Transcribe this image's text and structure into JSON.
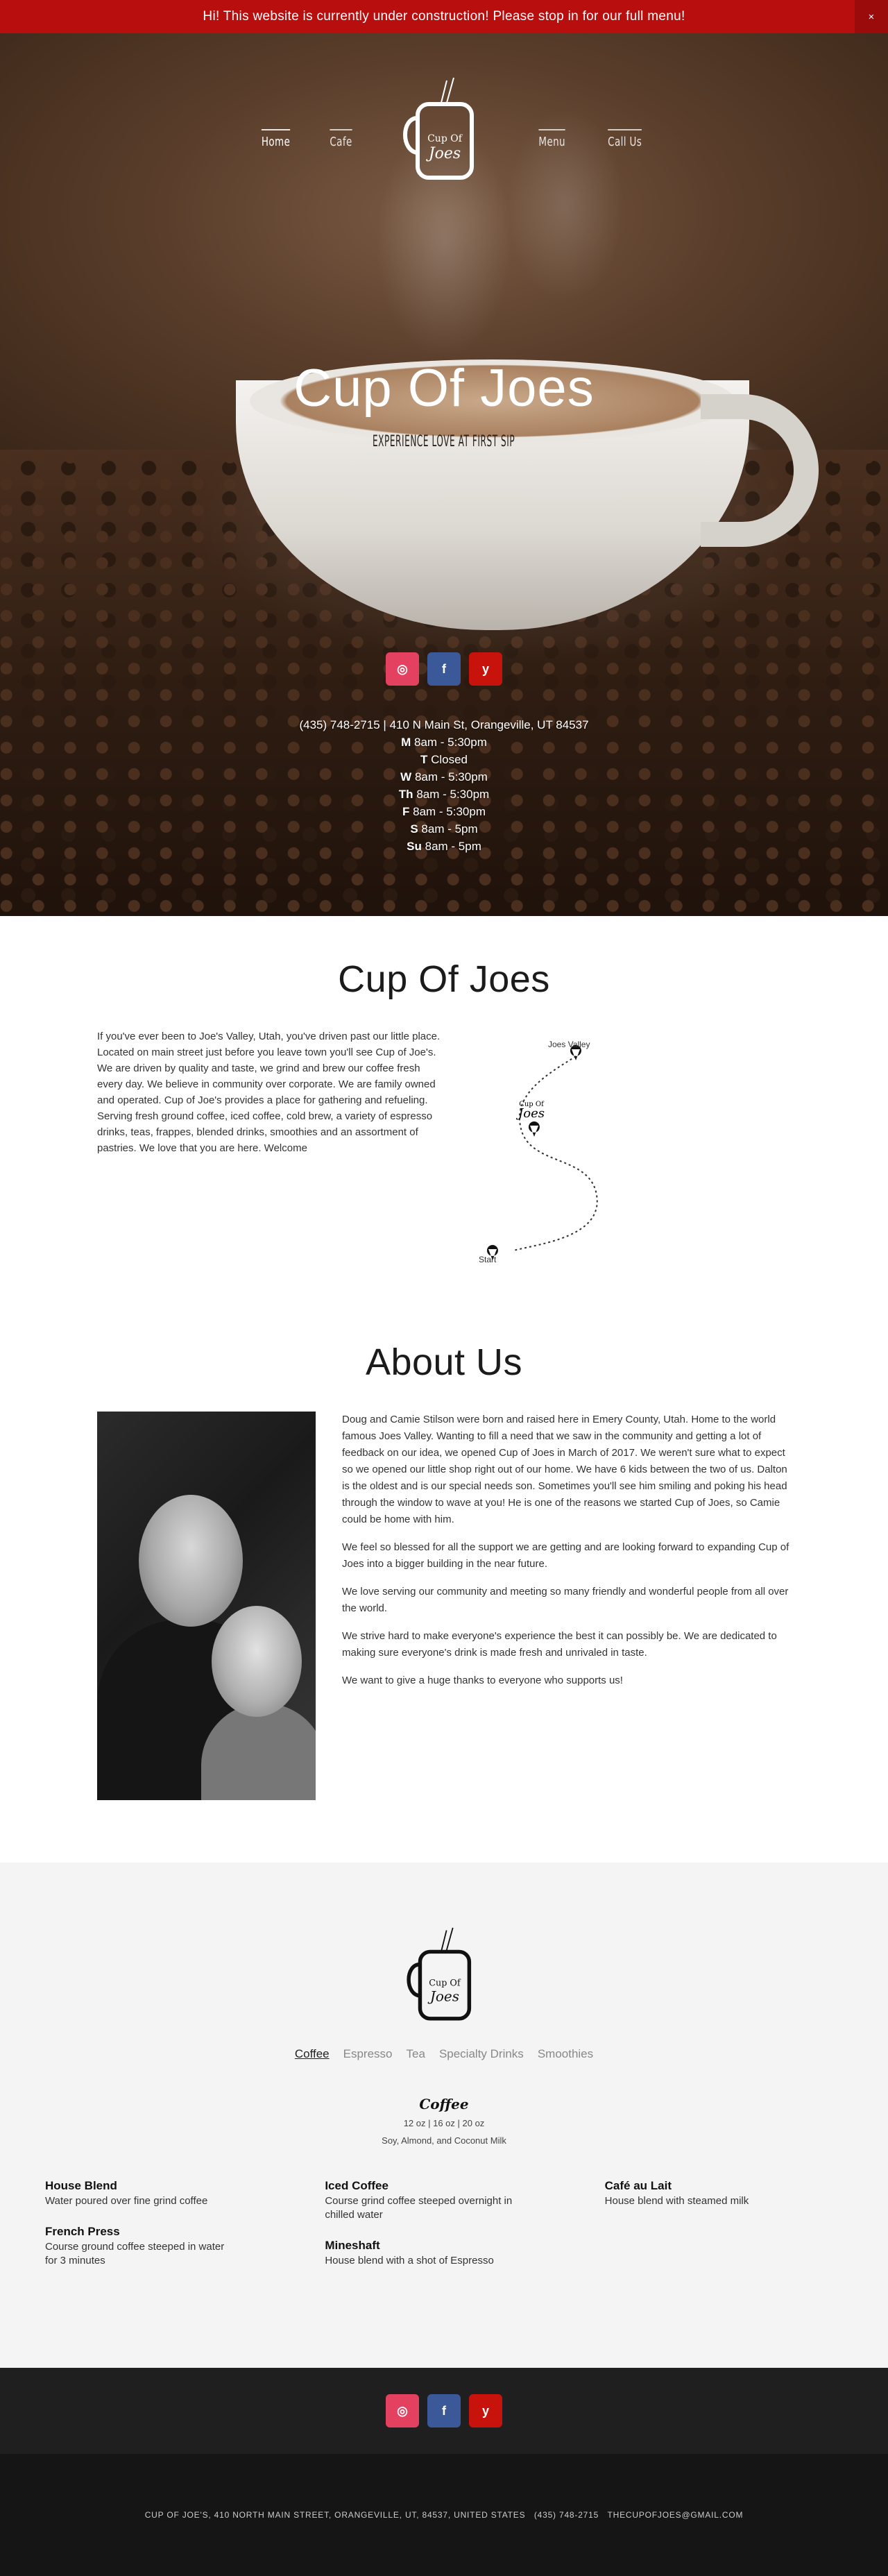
{
  "announcement": {
    "text": "Hi! This website is currently under construction! Please stop in for our full menu!",
    "close": "×"
  },
  "nav": {
    "home": "Home",
    "cafe": "Cafe",
    "menu": "Menu",
    "call": "Call Us"
  },
  "logo": {
    "line1": "Cup Of",
    "line2": "Joes"
  },
  "hero": {
    "title": "Cup Of Joes",
    "subtitle": "EXPERIENCE LOVE AT FIRST SIP"
  },
  "social": [
    {
      "label": "◎",
      "color": "#e4405f"
    },
    {
      "label": "f",
      "color": "#3b5998"
    },
    {
      "label": "y",
      "color": "#c8120c"
    }
  ],
  "contact": {
    "line": "(435) 748-2715 | 410 N Main St, Orangeville, UT 84537"
  },
  "hours": [
    {
      "day": "M",
      "time": "8am - 5:30pm"
    },
    {
      "day": "T",
      "time": "Closed"
    },
    {
      "day": "W",
      "time": "8am - 5:30pm"
    },
    {
      "day": "Th",
      "time": "8am - 5:30pm"
    },
    {
      "day": "F",
      "time": "8am - 5:30pm"
    },
    {
      "day": "S",
      "time": "8am - 5pm"
    },
    {
      "day": "Su",
      "time": "8am - 5pm"
    }
  ],
  "intro": {
    "title": "Cup Of Joes",
    "text": "If you've ever been to Joe's Valley, Utah, you've driven past our little place. Located on main street just before you leave town you'll see Cup of Joe's.  We are driven by quality and taste, we grind and brew our coffee fresh every day. We believe in community over corporate. We are family owned and operated. Cup of Joe's provides a place for gathering and refueling. Serving fresh ground coffee, iced coffee, cold brew, a variety of espresso drinks, teas, frappes, blended drinks, smoothies and an assortment of pastries. We love that you are here. Welcome",
    "map": {
      "top": "Joes Valley",
      "start": "Start"
    }
  },
  "about": {
    "title": "About Us",
    "paragraphs": [
      "Doug and Camie Stilson were born and raised here in Emery County, Utah. Home to the world famous Joes Valley. Wanting to fill a need that we saw in the community and getting a lot of feedback on our idea, we opened Cup of Joes in March of 2017. We weren't sure what to expect so we opened our little shop right out of our home. We have 6 kids between the two of us. Dalton is the oldest and is our special needs son. Sometimes you'll see him smiling and poking his head through the window to wave at you! He is one of the reasons we started Cup of Joes, so Camie could be home with him.",
      "We feel so blessed for all the support we are getting and are looking forward to expanding Cup of Joes into a bigger building in the near future.",
      "We love serving our community and meeting so many friendly and wonderful people from all over the world.",
      "We strive hard to make everyone's experience the best it can possibly be. We are dedicated to making sure everyone's drink is made fresh and unrivaled in taste.",
      "We want to give a huge thanks to everyone who supports us!"
    ]
  },
  "menu": {
    "tabs": [
      "Coffee",
      "Espresso",
      "Tea",
      "Specialty Drinks",
      "Smoothies"
    ],
    "active_tab": "Coffee",
    "heading": "Coffee",
    "sizes": "12 oz | 16 oz | 20 oz",
    "milks": "Soy, Almond, and Coconut Milk",
    "columns": [
      [
        {
          "name": "House Blend",
          "desc": "Water poured over fine grind coffee"
        },
        {
          "name": "French Press",
          "desc": "Course ground coffee steeped in water for 3 minutes"
        }
      ],
      [
        {
          "name": "Iced Coffee",
          "desc": "Course grind coffee steeped overnight in chilled water"
        },
        {
          "name": "Mineshaft",
          "desc": "House blend with a shot of Espresso"
        }
      ],
      [
        {
          "name": "Café au Lait",
          "desc": "House blend with steamed milk"
        }
      ]
    ]
  },
  "footer": {
    "address": "CUP OF JOE'S, 410 NORTH MAIN STREET, ORANGEVILLE, UT, 84537, UNITED STATES",
    "phone": "(435) 748-2715",
    "email": "THECUPOFJOES@GMAIL.COM"
  }
}
